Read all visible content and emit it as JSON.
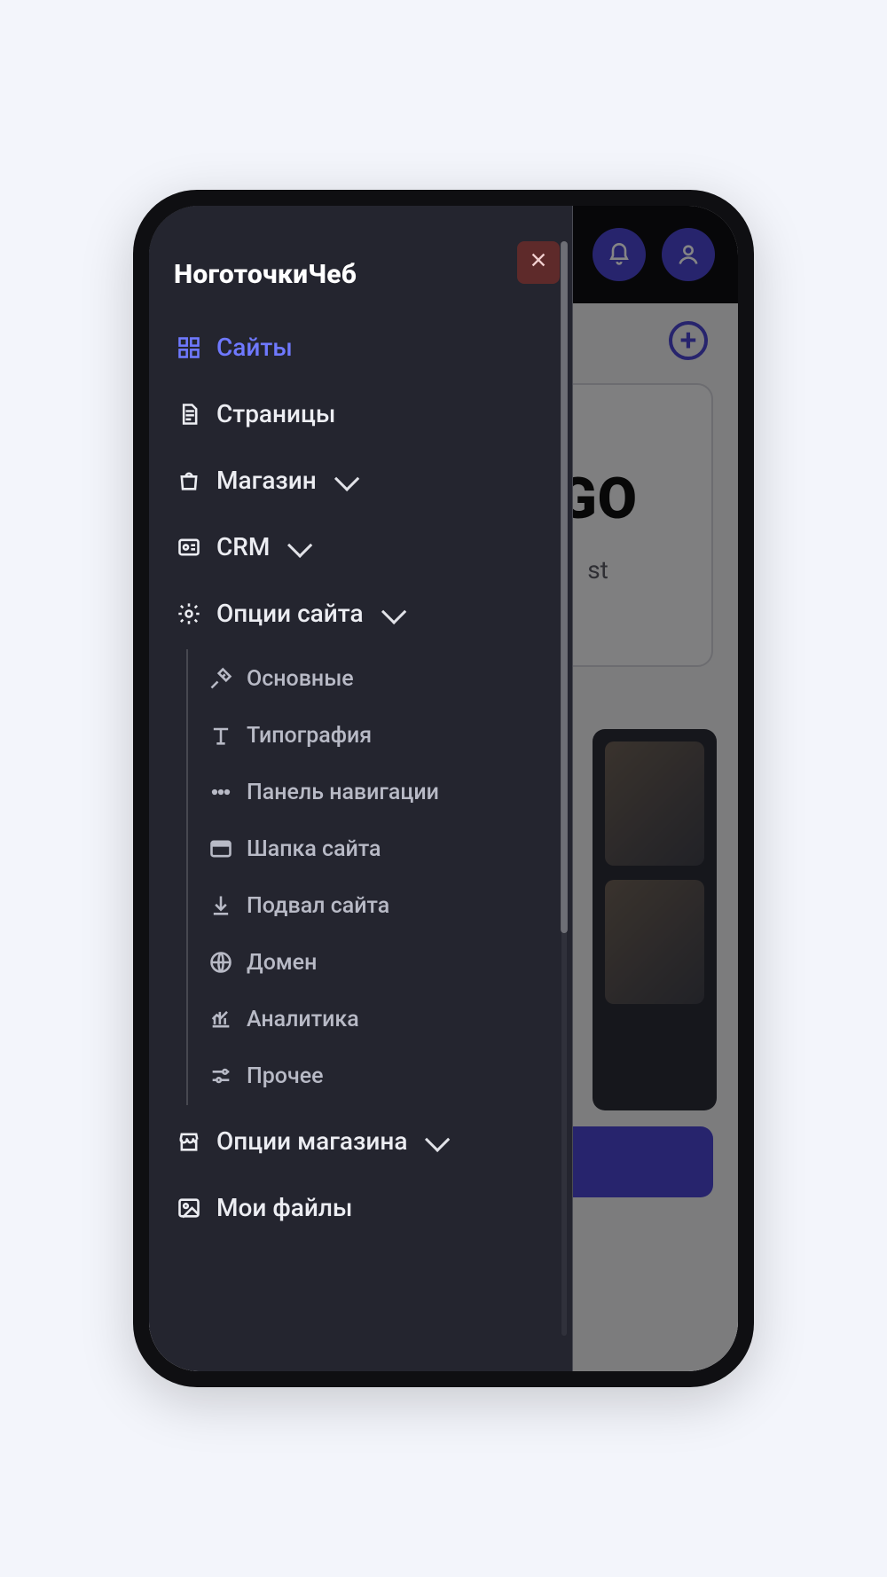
{
  "header": {
    "site_name": "НоготочкиЧеб"
  },
  "background": {
    "logo_partial": "GO",
    "subtitle_partial": "st"
  },
  "nav": {
    "sites": "Сайты",
    "pages": "Страницы",
    "shop": "Магазин",
    "crm": "CRM",
    "site_options": "Опции сайта",
    "shop_options": "Опции магазина",
    "my_files": "Мои файлы"
  },
  "site_options_sub": {
    "general": "Основные",
    "typography": "Типография",
    "nav_panel": "Панель навигации",
    "header": "Шапка сайта",
    "footer": "Подвал сайта",
    "domain": "Домен",
    "analytics": "Аналитика",
    "other": "Прочее"
  },
  "colors": {
    "accent": "#4b46d1",
    "drawer_bg": "#24252f",
    "active": "#6f79ff",
    "close_bg": "#5e2a2a"
  }
}
